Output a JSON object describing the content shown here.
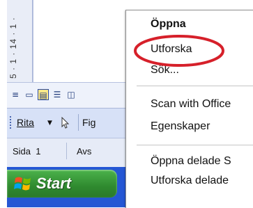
{
  "app": {
    "ruler_text": "5 · 1 · 14 · 1 ·",
    "view_buttons": [
      "normal-view-icon",
      "web-layout-icon",
      "print-layout-icon",
      "outline-view-icon",
      "reading-layout-icon"
    ],
    "view_glyphs": [
      "≡",
      "▭",
      "▤",
      "☰",
      "◫"
    ]
  },
  "drawbar": {
    "rita_label": "Rita",
    "arrow": "▼",
    "fig_label": "Fig"
  },
  "status": {
    "page": "Sida  1",
    "section": "Avs"
  },
  "taskbar": {
    "start_label": "Start"
  },
  "menu": {
    "items": [
      {
        "label": "Öppna",
        "bold": true
      },
      {
        "label": "Utforska"
      },
      {
        "label": "Sök..."
      },
      {
        "label": "Scan with Office"
      },
      {
        "label": "Egenskaper"
      },
      {
        "label": "Öppna delade S"
      },
      {
        "label": "Utforska delade"
      }
    ]
  },
  "colors": {
    "highlight": "#d6202a",
    "taskbar": "#2557d4",
    "start_green": "#3c9c3c"
  }
}
